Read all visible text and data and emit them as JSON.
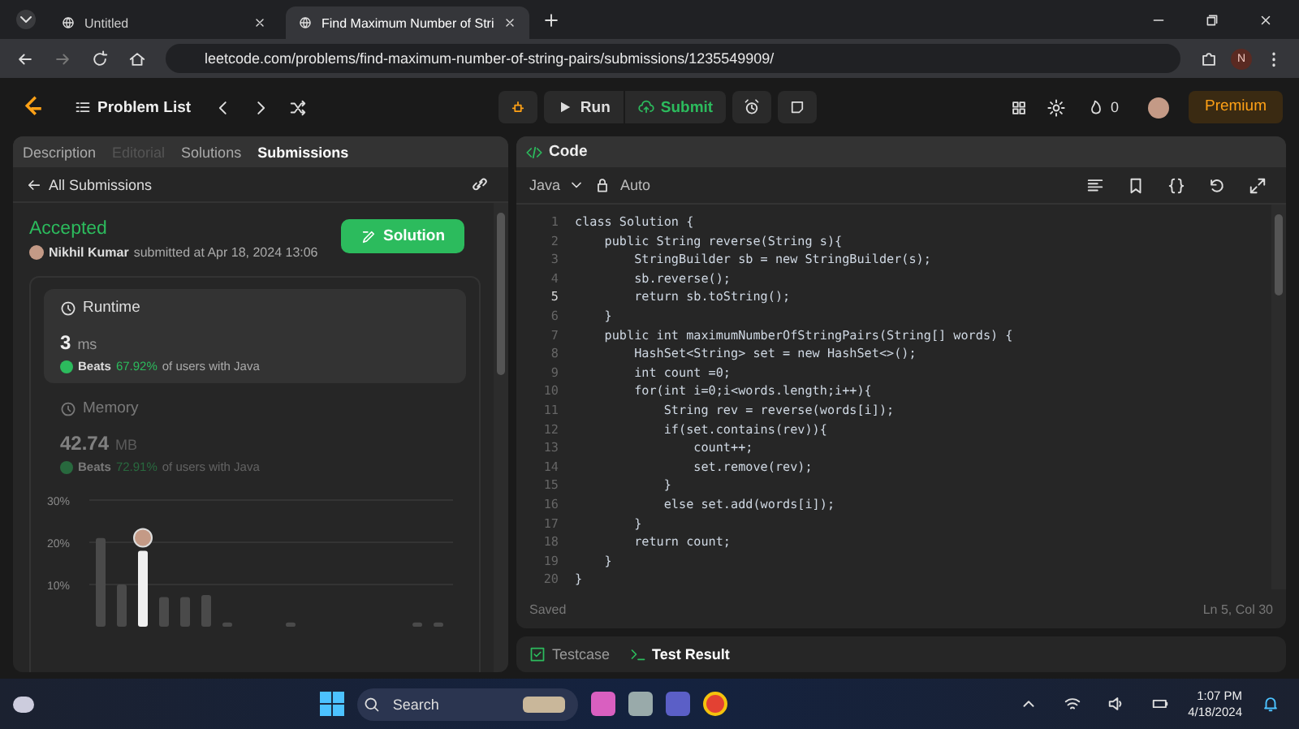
{
  "browser": {
    "tabs": [
      {
        "title": "Untitled",
        "selected": false
      },
      {
        "title": "Find Maximum Number of Stri",
        "selected": true
      }
    ],
    "url": "leetcode.com/problems/find-maximum-number-of-string-pairs/submissions/1235549909/",
    "profile_initial": "N"
  },
  "navbar": {
    "problem_list": "Problem List",
    "run": "Run",
    "submit": "Submit",
    "streak": "0",
    "premium": "Premium"
  },
  "left_panel": {
    "tabs": [
      {
        "label": "Description",
        "selected": false,
        "disabled": false
      },
      {
        "label": "Editorial",
        "selected": false,
        "disabled": true
      },
      {
        "label": "Solutions",
        "selected": false,
        "disabled": false
      },
      {
        "label": "Submissions",
        "selected": true,
        "disabled": false
      }
    ],
    "back_link": "All Submissions",
    "status": "Accepted",
    "author": "Nikhil Kumar",
    "submitted": "submitted at Apr 18, 2024 13:06",
    "solution_button": "Solution",
    "metrics": [
      {
        "title": "Runtime",
        "value": "3",
        "unit": "ms",
        "beats": "Beats",
        "percent": "67.92%",
        "suffix": "of users with Java",
        "selected": true
      },
      {
        "title": "Memory",
        "value": "42.74",
        "unit": "MB",
        "beats": "Beats",
        "percent": "72.91%",
        "suffix": "of users with Java",
        "selected": false
      }
    ],
    "chart_data": {
      "type": "bar",
      "ylim": [
        0,
        30
      ],
      "yticks": [
        {
          "value": 30,
          "label": "30%"
        },
        {
          "value": 20,
          "label": "20%"
        },
        {
          "value": 10,
          "label": "10%"
        }
      ],
      "series": [
        {
          "color": "#4a4a4a",
          "values": [
            21,
            10,
            null,
            7,
            7,
            7.5,
            1,
            null,
            null,
            1,
            null,
            null,
            null,
            null,
            null,
            1,
            1
          ]
        },
        {
          "color": "#f0f0f0",
          "values": [
            null,
            null,
            18,
            null,
            null,
            null,
            null,
            null,
            null,
            null,
            null,
            null,
            null,
            null,
            null,
            null,
            null
          ]
        }
      ]
    }
  },
  "code_panel": {
    "title": "Code",
    "language": "Java",
    "mode": "Auto",
    "lines": [
      {
        "number": "1",
        "text": "class Solution {",
        "active": false
      },
      {
        "number": "2",
        "text": "    public String reverse(String s){",
        "active": false
      },
      {
        "number": "3",
        "text": "        StringBuilder sb = new StringBuilder(s);",
        "active": false
      },
      {
        "number": "4",
        "text": "        sb.reverse();",
        "active": false
      },
      {
        "number": "5",
        "text": "        return sb.toString();",
        "active": true
      },
      {
        "number": "6",
        "text": "    }",
        "active": false
      },
      {
        "number": "7",
        "text": "    public int maximumNumberOfStringPairs(String[] words) {",
        "active": false
      },
      {
        "number": "8",
        "text": "        HashSet<String> set = new HashSet<>();",
        "active": false
      },
      {
        "number": "9",
        "text": "        int count =0;",
        "active": false
      },
      {
        "number": "10",
        "text": "        for(int i=0;i<words.length;i++){",
        "active": false
      },
      {
        "number": "11",
        "text": "            String rev = reverse(words[i]);",
        "active": false
      },
      {
        "number": "12",
        "text": "            if(set.contains(rev)){",
        "active": false
      },
      {
        "number": "13",
        "text": "                count++;",
        "active": false
      },
      {
        "number": "14",
        "text": "                set.remove(rev);",
        "active": false
      },
      {
        "number": "15",
        "text": "            }",
        "active": false
      },
      {
        "number": "16",
        "text": "            else set.add(words[i]);",
        "active": false
      },
      {
        "number": "17",
        "text": "        }",
        "active": false
      },
      {
        "number": "18",
        "text": "        return count;",
        "active": false
      },
      {
        "number": "19",
        "text": "    }",
        "active": false
      },
      {
        "number": "20",
        "text": "}",
        "active": false
      }
    ],
    "saved": "Saved",
    "cursor": "Ln 5, Col 30",
    "bottom_tabs": [
      {
        "label": "Testcase",
        "selected": false
      },
      {
        "label": "Test Result",
        "selected": true
      }
    ]
  },
  "taskbar": {
    "placeholder": "Search",
    "time": "1:07 PM",
    "date": "4/18/2024"
  }
}
